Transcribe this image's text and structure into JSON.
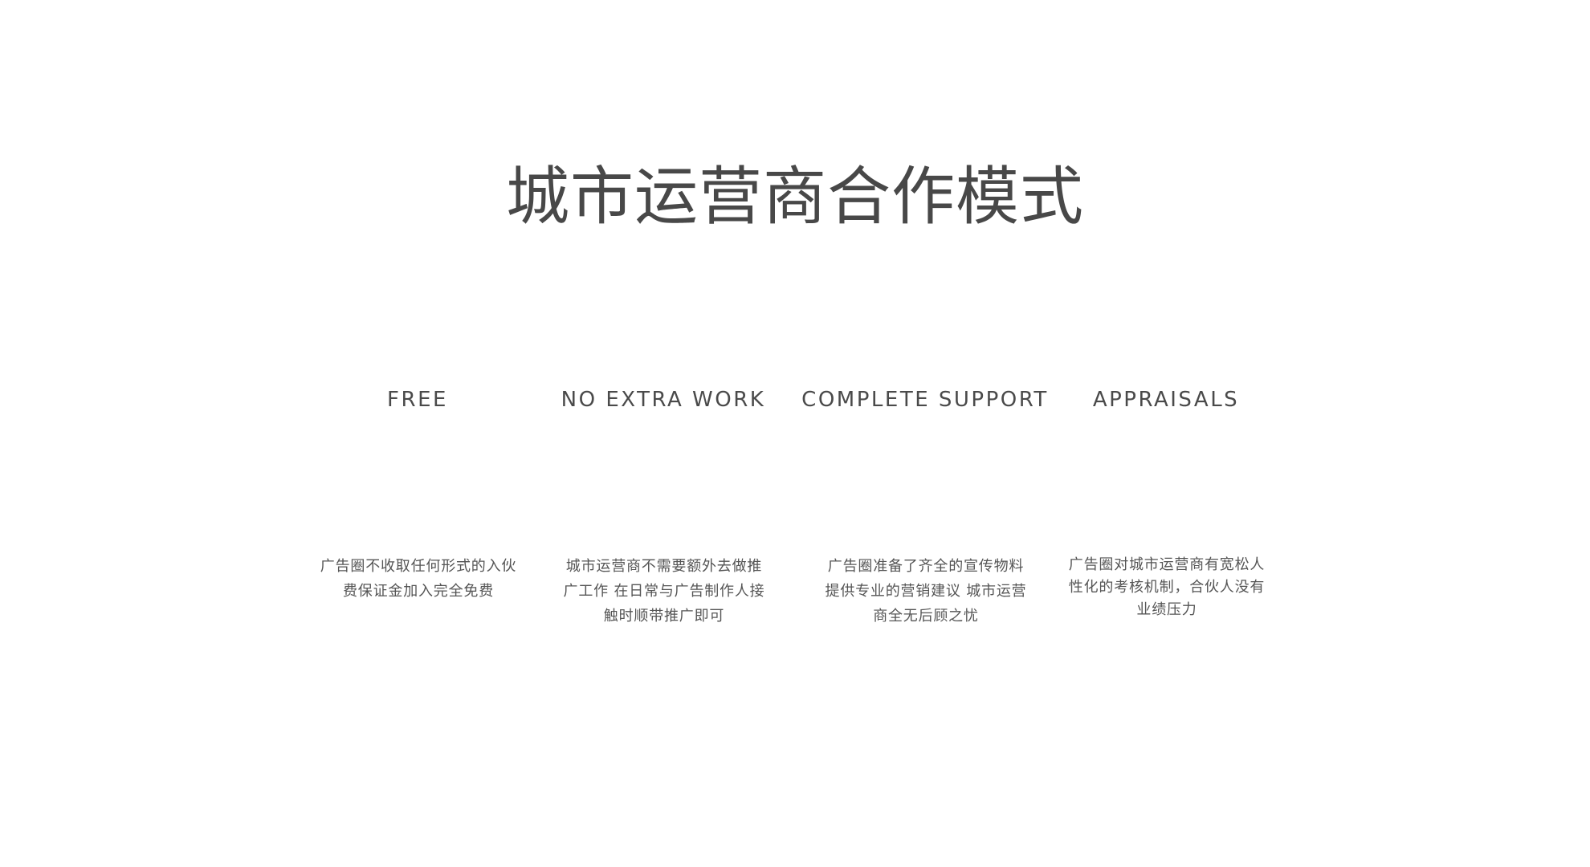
{
  "title": "城市运营商合作模式",
  "features": [
    {
      "heading": "FREE",
      "description": "广告圈不收取任何形式的入伙费保证金加入完全免费"
    },
    {
      "heading": "NO EXTRA WORK",
      "description": "城市运营商不需要额外去做推广工作 在日常与广告制作人接触时顺带推广即可"
    },
    {
      "heading": "COMPLETE SUPPORT",
      "description": "广告圈准备了齐全的宣传物料提供专业的营销建议 城市运营商全无后顾之忧"
    },
    {
      "heading": "APPRAISALS",
      "description": "广告圈对城市运营商有宽松人性化的考核机制，合伙人没有业绩压力"
    }
  ]
}
